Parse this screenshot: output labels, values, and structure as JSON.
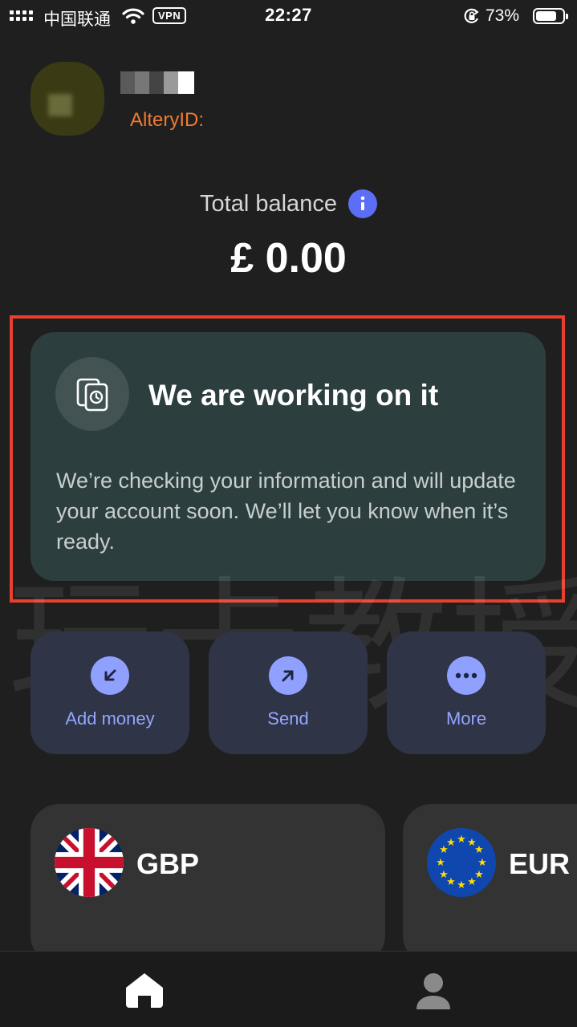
{
  "status_bar": {
    "carrier": "中国联通",
    "vpn": "VPN",
    "time": "22:27",
    "battery": "73%"
  },
  "profile": {
    "altery_id_label": "AlteryID:"
  },
  "balance": {
    "label": "Total balance",
    "amount": "£ 0.00"
  },
  "notice": {
    "title": "We are working on it",
    "body": "We’re checking your information and will update your account soon. We’ll let you know when it’s ready."
  },
  "actions": [
    {
      "label": "Add money",
      "icon": "arrow-down-left-icon"
    },
    {
      "label": "Send",
      "icon": "arrow-up-right-icon"
    },
    {
      "label": "More",
      "icon": "more-dots-icon"
    }
  ],
  "currencies": [
    {
      "code": "GBP",
      "flag": "uk-flag-icon"
    },
    {
      "code": "EUR",
      "flag": "eu-flag-icon"
    }
  ],
  "watermark": "玩卡教授",
  "colors": {
    "background": "#1f1f1f",
    "accent_orange": "#f07a33",
    "info_blue": "#5b6ef5",
    "notice_card": "#2d3e3f",
    "action_card": "#2f3446",
    "action_accent": "#93a6ff",
    "highlight_red": "#e8402c"
  }
}
